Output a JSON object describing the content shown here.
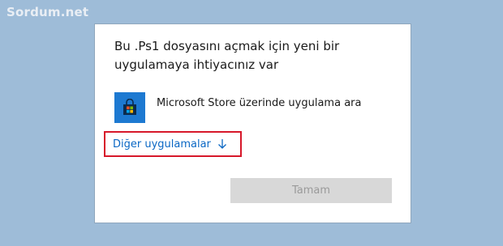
{
  "watermark": {
    "text": "Sordum.net"
  },
  "dialog": {
    "heading": "Bu .Ps1 dosyasını açmak için yeni bir uygulamaya ihtiyacınız var",
    "store_option": {
      "label": "Microsoft Store üzerinde uygulama ara",
      "icon": "microsoft-store-icon"
    },
    "more_apps": {
      "label": "Diğer uygulamalar",
      "icon": "arrow-down-icon",
      "highlight_color": "#d7182a"
    },
    "ok_button": {
      "label": "Tamam",
      "disabled": true
    }
  },
  "colors": {
    "desktop_background": "#9ebcd8",
    "link_blue": "#0a67c4",
    "store_icon_blue": "#1d79d1"
  }
}
